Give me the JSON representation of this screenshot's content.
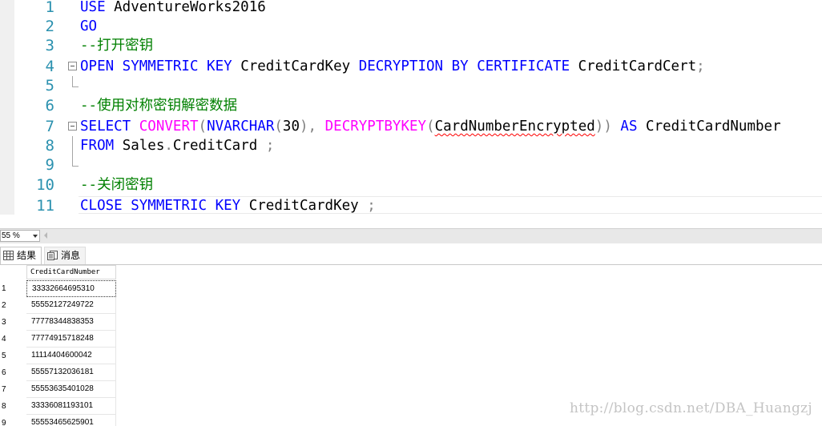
{
  "editor": {
    "lines": [
      {
        "num": "1",
        "fold": "none",
        "tokens": [
          {
            "c": "kw",
            "t": "USE"
          },
          {
            "c": "tx",
            "t": " AdventureWorks2016"
          }
        ]
      },
      {
        "num": "2",
        "fold": "none",
        "tokens": [
          {
            "c": "kw",
            "t": "GO"
          }
        ]
      },
      {
        "num": "3",
        "fold": "none",
        "tokens": [
          {
            "c": "cm",
            "t": "--打开密钥"
          }
        ]
      },
      {
        "num": "4",
        "fold": "start",
        "tokens": [
          {
            "c": "kw",
            "t": "OPEN SYMMETRIC KEY"
          },
          {
            "c": "tx",
            "t": " CreditCardKey "
          },
          {
            "c": "kw",
            "t": "DECRYPTION BY CERTIFICATE"
          },
          {
            "c": "tx",
            "t": " CreditCardCert"
          },
          {
            "c": "gr",
            "t": ";"
          }
        ]
      },
      {
        "num": "5",
        "fold": "end",
        "tokens": []
      },
      {
        "num": "6",
        "fold": "none",
        "tokens": [
          {
            "c": "cm",
            "t": "--使用对称密钥解密数据"
          }
        ]
      },
      {
        "num": "7",
        "fold": "start",
        "tokens": [
          {
            "c": "kw",
            "t": "SELECT"
          },
          {
            "c": "tx",
            "t": " "
          },
          {
            "c": "fn",
            "t": "CONVERT"
          },
          {
            "c": "gr",
            "t": "("
          },
          {
            "c": "kw",
            "t": "NVARCHAR"
          },
          {
            "c": "gr",
            "t": "("
          },
          {
            "c": "tx",
            "t": "30"
          },
          {
            "c": "gr",
            "t": "),"
          },
          {
            "c": "tx",
            "t": " "
          },
          {
            "c": "fn",
            "t": "DECRYPTBYKEY"
          },
          {
            "c": "gr",
            "t": "("
          },
          {
            "c": "tx squiggle",
            "t": "CardNumberEncrypted"
          },
          {
            "c": "gr",
            "t": "))"
          },
          {
            "c": "tx",
            "t": " "
          },
          {
            "c": "kw",
            "t": "AS"
          },
          {
            "c": "tx",
            "t": " CreditCardNumber"
          }
        ]
      },
      {
        "num": "8",
        "fold": "line",
        "tokens": [
          {
            "c": "kw",
            "t": "FROM"
          },
          {
            "c": "tx",
            "t": " Sales"
          },
          {
            "c": "gr",
            "t": "."
          },
          {
            "c": "tx",
            "t": "CreditCard "
          },
          {
            "c": "gr",
            "t": ";"
          }
        ]
      },
      {
        "num": "9",
        "fold": "end",
        "tokens": []
      },
      {
        "num": "10",
        "fold": "none",
        "tokens": [
          {
            "c": "cm",
            "t": "--关闭密钥"
          }
        ]
      },
      {
        "num": "11",
        "fold": "none",
        "tokens": [
          {
            "c": "kw",
            "t": "CLOSE SYMMETRIC KEY"
          },
          {
            "c": "tx",
            "t": " CreditCardKey "
          },
          {
            "c": "gr",
            "t": ";"
          }
        ]
      }
    ]
  },
  "zoom": {
    "value": "55 %"
  },
  "tabs": {
    "results": "结果",
    "messages": "消息"
  },
  "grid": {
    "column": "CreditCardNumber",
    "rows": [
      {
        "num": "1",
        "value": "33332664695310"
      },
      {
        "num": "2",
        "value": "55552127249722"
      },
      {
        "num": "3",
        "value": "77778344838353"
      },
      {
        "num": "4",
        "value": "77774915718248"
      },
      {
        "num": "5",
        "value": "11114404600042"
      },
      {
        "num": "6",
        "value": "55557132036181"
      },
      {
        "num": "7",
        "value": "55553635401028"
      },
      {
        "num": "8",
        "value": "33336081193101"
      },
      {
        "num": "9",
        "value": "55553465625901"
      }
    ]
  },
  "watermark": "http://blog.csdn.net/DBA_Huangzj"
}
